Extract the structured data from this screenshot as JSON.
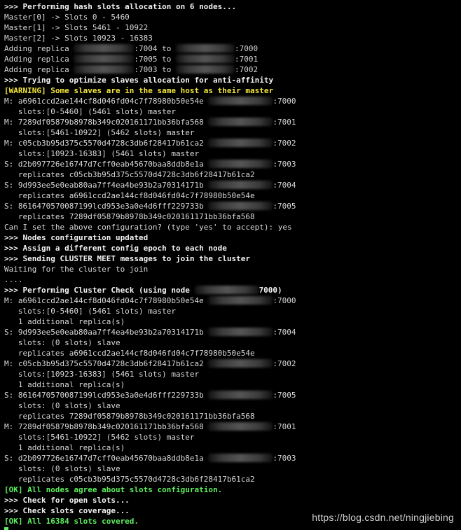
{
  "terminal": {
    "lines": [
      {
        "t": "bold",
        "text": ">>> Performing hash slots allocation on 6 nodes..."
      },
      {
        "t": "normal",
        "text": "Master[0] -> Slots 0 - 5460"
      },
      {
        "t": "normal",
        "text": "Master[1] -> Slots 5461 - 10922"
      },
      {
        "t": "normal",
        "text": "Master[2] -> Slots 10923 - 16383"
      },
      {
        "t": "normal",
        "pre": "Adding replica ",
        "ipA": "a",
        "mid": ":7004 to ",
        "ipB": "b",
        "post": ":7000"
      },
      {
        "t": "normal",
        "pre": "Adding replica ",
        "ipA": "a",
        "mid": ":7005 to ",
        "ipB": "b",
        "post": ":7001"
      },
      {
        "t": "normal",
        "pre": "Adding replica ",
        "ipA": "a",
        "mid": ":7003 to ",
        "ipB": "b",
        "post": ":7002"
      },
      {
        "t": "bold",
        "text": ">>> Trying to optimize slaves allocation for anti-affinity"
      },
      {
        "t": "warn",
        "text": "[WARNING] Some slaves are in the same host as their master"
      },
      {
        "t": "normal",
        "pre": "M: a6961ccd2ae144cf8d046fd04c7f78980b50e54e ",
        "ipA": "c",
        "post": ":7000"
      },
      {
        "t": "normal",
        "text": "   slots:[0-5460] (5461 slots) master"
      },
      {
        "t": "normal",
        "pre": "M: 7289df05879b8978b349c020161171bb36bfa568 ",
        "ipA": "c",
        "post": ":7001"
      },
      {
        "t": "normal",
        "text": "   slots:[5461-10922] (5462 slots) master"
      },
      {
        "t": "normal",
        "pre": "M: c05cb3b95d375c5570d4728c3db6f28417b61ca2 ",
        "ipA": "c",
        "post": ":7002"
      },
      {
        "t": "normal",
        "text": "   slots:[10923-16383] (5461 slots) master"
      },
      {
        "t": "normal",
        "pre": "S: d2b097726e16747d7cff0eab45670baa8ddb8e1a ",
        "ipA": "c",
        "post": ":7003"
      },
      {
        "t": "normal",
        "text": "   replicates c05cb3b95d375c5570d4728c3db6f28417b61ca2"
      },
      {
        "t": "normal",
        "pre": "S: 9d993ee5e0eab80aa7ff4ea4be93b2a70314171b ",
        "ipA": "c",
        "post": ":7004"
      },
      {
        "t": "normal",
        "text": "   replicates a6961ccd2ae144cf8d046fd04c7f78980b50e54e"
      },
      {
        "t": "normal",
        "pre": "S: 8616470570087199lcd953e3a0e4d6fff229733b ",
        "ipA": "c",
        "post": ":7005"
      },
      {
        "t": "normal",
        "text": "   replicates 7289df05879b8978b349c020161171bb36bfa568"
      },
      {
        "t": "normal",
        "text": "Can I set the above configuration? (type 'yes' to accept): yes"
      },
      {
        "t": "bold",
        "text": ">>> Nodes configuration updated"
      },
      {
        "t": "bold",
        "text": ">>> Assign a different config epoch to each node"
      },
      {
        "t": "bold",
        "text": ">>> Sending CLUSTER MEET messages to join the cluster"
      },
      {
        "t": "normal",
        "text": "Waiting for the cluster to join"
      },
      {
        "t": "normal",
        "text": "...."
      },
      {
        "t": "bold",
        "pre": ">>> Performing Cluster Check (using node ",
        "ipA": "c",
        "post": "7000)"
      },
      {
        "t": "normal",
        "pre": "M: a6961ccd2ae144cf8d046fd04c7f78980b50e54e ",
        "ipA": "c",
        "post": ":7000"
      },
      {
        "t": "normal",
        "text": "   slots:[0-5460] (5461 slots) master"
      },
      {
        "t": "normal",
        "text": "   1 additional replica(s)"
      },
      {
        "t": "normal",
        "pre": "S: 9d993ee5e0eab80aa7ff4ea4be93b2a70314171b ",
        "ipA": "c",
        "post": ":7004"
      },
      {
        "t": "normal",
        "text": "   slots: (0 slots) slave"
      },
      {
        "t": "normal",
        "text": "   replicates a6961ccd2ae144cf8d046fd04c7f78980b50e54e"
      },
      {
        "t": "normal",
        "pre": "M: c05cb3b95d375c5570d4728c3db6f28417b61ca2 ",
        "ipA": "c",
        "post": ":7002"
      },
      {
        "t": "normal",
        "text": "   slots:[10923-16383] (5461 slots) master"
      },
      {
        "t": "normal",
        "text": "   1 additional replica(s)"
      },
      {
        "t": "normal",
        "pre": "S: 8616470570087199lcd953e3a0e4d6fff229733b ",
        "ipA": "c",
        "post": ":7005"
      },
      {
        "t": "normal",
        "text": "   slots: (0 slots) slave"
      },
      {
        "t": "normal",
        "text": "   replicates 7289df05879b8978b349c020161171bb36bfa568"
      },
      {
        "t": "normal",
        "pre": "M: 7289df05879b8978b349c020161171bb36bfa568 ",
        "ipA": "c",
        "post": ":7001"
      },
      {
        "t": "normal",
        "text": "   slots:[5461-10922] (5462 slots) master"
      },
      {
        "t": "normal",
        "text": "   1 additional replica(s)"
      },
      {
        "t": "normal",
        "pre": "S: d2b097726e16747d7cff0eab45670baa8ddb8e1a ",
        "ipA": "c",
        "post": ":7003"
      },
      {
        "t": "normal",
        "text": "   slots: (0 slots) slave"
      },
      {
        "t": "normal",
        "text": "   replicates c05cb3b95d375c5570d4728c3db6f28417b61ca2"
      },
      {
        "t": "ok",
        "text": "[OK] All nodes agree about slots configuration."
      },
      {
        "t": "bold",
        "text": ">>> Check for open slots..."
      },
      {
        "t": "bold",
        "text": ">>> Check slots coverage..."
      },
      {
        "t": "ok",
        "text": "[OK] All 16384 slots covered."
      },
      {
        "t": "prompt",
        "text": ""
      }
    ]
  },
  "watermark": "https://blog.csdn.net/ningjiebing",
  "colors": {
    "background": "#000000",
    "text": "#d8d8d8",
    "warning": "#f2e63a",
    "ok": "#5ef05e"
  }
}
